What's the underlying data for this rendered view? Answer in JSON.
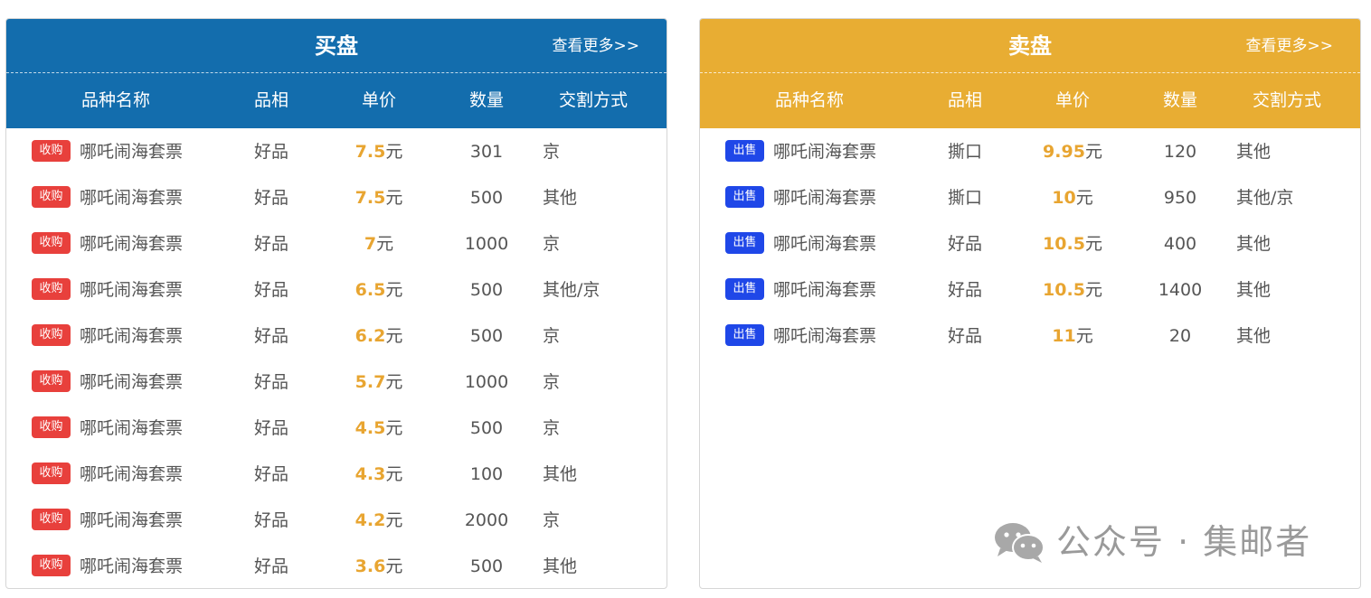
{
  "buy": {
    "title": "买盘",
    "more": "查看更多>>",
    "columns": [
      "品种名称",
      "品相",
      "单价",
      "数量",
      "交割方式"
    ],
    "tag": "收购",
    "unit": "元",
    "rows": [
      {
        "name": "哪吒闹海套票",
        "grade": "好品",
        "price": "7.5",
        "qty": "301",
        "method": "京"
      },
      {
        "name": "哪吒闹海套票",
        "grade": "好品",
        "price": "7.5",
        "qty": "500",
        "method": "其他"
      },
      {
        "name": "哪吒闹海套票",
        "grade": "好品",
        "price": "7",
        "qty": "1000",
        "method": "京"
      },
      {
        "name": "哪吒闹海套票",
        "grade": "好品",
        "price": "6.5",
        "qty": "500",
        "method": "其他/京"
      },
      {
        "name": "哪吒闹海套票",
        "grade": "好品",
        "price": "6.2",
        "qty": "500",
        "method": "京"
      },
      {
        "name": "哪吒闹海套票",
        "grade": "好品",
        "price": "5.7",
        "qty": "1000",
        "method": "京"
      },
      {
        "name": "哪吒闹海套票",
        "grade": "好品",
        "price": "4.5",
        "qty": "500",
        "method": "京"
      },
      {
        "name": "哪吒闹海套票",
        "grade": "好品",
        "price": "4.3",
        "qty": "100",
        "method": "其他"
      },
      {
        "name": "哪吒闹海套票",
        "grade": "好品",
        "price": "4.2",
        "qty": "2000",
        "method": "京"
      },
      {
        "name": "哪吒闹海套票",
        "grade": "好品",
        "price": "3.6",
        "qty": "500",
        "method": "其他"
      }
    ]
  },
  "sell": {
    "title": "卖盘",
    "more": "查看更多>>",
    "columns": [
      "品种名称",
      "品相",
      "单价",
      "数量",
      "交割方式"
    ],
    "tag": "出售",
    "unit": "元",
    "rows": [
      {
        "name": "哪吒闹海套票",
        "grade": "撕口",
        "price": "9.95",
        "qty": "120",
        "method": "其他"
      },
      {
        "name": "哪吒闹海套票",
        "grade": "撕口",
        "price": "10",
        "qty": "950",
        "method": "其他/京"
      },
      {
        "name": "哪吒闹海套票",
        "grade": "好品",
        "price": "10.5",
        "qty": "400",
        "method": "其他"
      },
      {
        "name": "哪吒闹海套票",
        "grade": "好品",
        "price": "10.5",
        "qty": "1400",
        "method": "其他"
      },
      {
        "name": "哪吒闹海套票",
        "grade": "好品",
        "price": "11",
        "qty": "20",
        "method": "其他"
      }
    ]
  },
  "watermark": {
    "text": "公众号 · 集邮者",
    "icon": "wechat-icon"
  },
  "colors": {
    "buy_header": "#136dad",
    "sell_header": "#e8ad33",
    "buy_tag": "#e8403c",
    "sell_tag": "#1f47e8",
    "price_accent": "#e8a531"
  }
}
